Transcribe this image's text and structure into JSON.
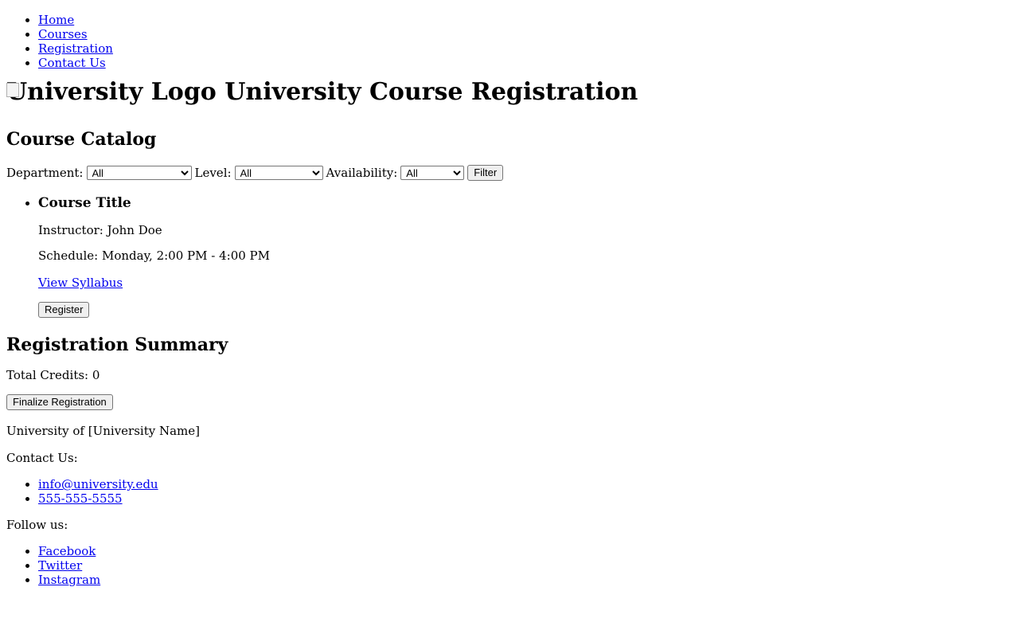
{
  "nav": {
    "items": [
      "Home",
      "Courses",
      "Registration",
      "Contact Us"
    ]
  },
  "header": {
    "logo_alt": "University Logo",
    "title": "University Course Registration"
  },
  "catalog": {
    "heading": "Course Catalog",
    "filters": {
      "department_label": "Department:",
      "department_value": "All",
      "level_label": "Level:",
      "level_value": "All",
      "availability_label": "Availability:",
      "availability_value": "All",
      "filter_button": "Filter"
    },
    "courses": [
      {
        "title": "Course Title",
        "instructor": "Instructor: John Doe",
        "schedule": "Schedule: Monday, 2:00 PM - 4:00 PM",
        "syllabus_link": "View Syllabus",
        "register_button": "Register"
      }
    ]
  },
  "summary": {
    "heading": "Registration Summary",
    "credits": "Total Credits: 0",
    "finalize_button": "Finalize Registration"
  },
  "footer": {
    "university": "University of [University Name]",
    "contact_label": "Contact Us:",
    "contacts": [
      "info@university.edu",
      "555-555-5555"
    ],
    "follow_label": "Follow us:",
    "social": [
      "Facebook",
      "Twitter",
      "Instagram"
    ]
  }
}
